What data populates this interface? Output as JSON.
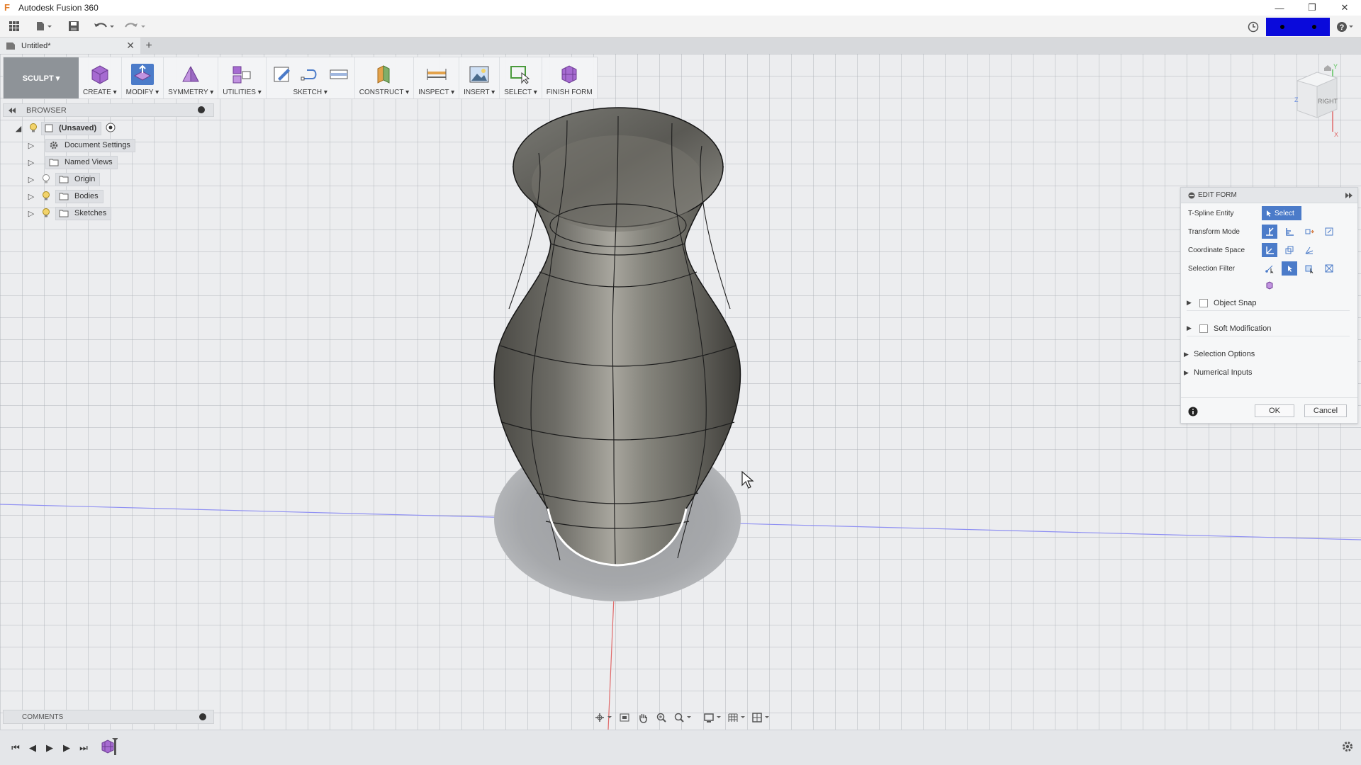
{
  "window": {
    "title": "Autodesk Fusion 360",
    "app_icon": "F",
    "minimize": "—",
    "restore": "❐",
    "close": "✕"
  },
  "quick_access": {
    "apps_icon": "grid-icon",
    "file_icon": "file-icon",
    "save_icon": "save-icon",
    "undo_icon": "undo-icon",
    "redo_icon": "redo-icon",
    "job_status_icon": "clock-icon",
    "help_icon": "help-icon",
    "user_badge_color": "#0a0adb"
  },
  "document_tab": {
    "label": "Untitled*",
    "close": "✕",
    "new_tab": "+"
  },
  "toolbar": {
    "workspace": "SCULPT ▾",
    "groups": [
      {
        "label": "CREATE ▾"
      },
      {
        "label": "MODIFY ▾"
      },
      {
        "label": "SYMMETRY ▾"
      },
      {
        "label": "UTILITIES ▾"
      },
      {
        "label": "SKETCH ▾"
      },
      {
        "label": "CONSTRUCT ▾"
      },
      {
        "label": "INSPECT ▾"
      },
      {
        "label": "INSERT ▾"
      },
      {
        "label": "SELECT ▾"
      },
      {
        "label": "FINISH FORM"
      }
    ],
    "active_color": "#4b7bc9"
  },
  "browser": {
    "title": "BROWSER",
    "root": "(Unsaved)",
    "items": [
      {
        "label": "Document Settings"
      },
      {
        "label": "Named Views"
      },
      {
        "label": "Origin"
      },
      {
        "label": "Bodies"
      },
      {
        "label": "Sketches"
      }
    ]
  },
  "view_cube": {
    "face": "RIGHT",
    "axis_y": "Y",
    "axis_z": "Z",
    "axis_x": "X"
  },
  "edit_form": {
    "title": "EDIT FORM",
    "tspline_entity_label": "T-Spline Entity",
    "select_label": "Select",
    "transform_mode_label": "Transform Mode",
    "coordinate_space_label": "Coordinate Space",
    "selection_filter_label": "Selection Filter",
    "object_snap_label": "Object Snap",
    "soft_modification_label": "Soft Modification",
    "selection_options_label": "Selection Options",
    "numerical_inputs_label": "Numerical Inputs",
    "ok_label": "OK",
    "cancel_label": "Cancel"
  },
  "comments": {
    "title": "COMMENTS"
  },
  "timeline": {
    "first": "⏮",
    "prev": "◀",
    "play": "▶",
    "next": "▶",
    "last": "⏭"
  },
  "model": {
    "surface_color": "#6d6c66",
    "highlight_color": "#a8a69e"
  }
}
